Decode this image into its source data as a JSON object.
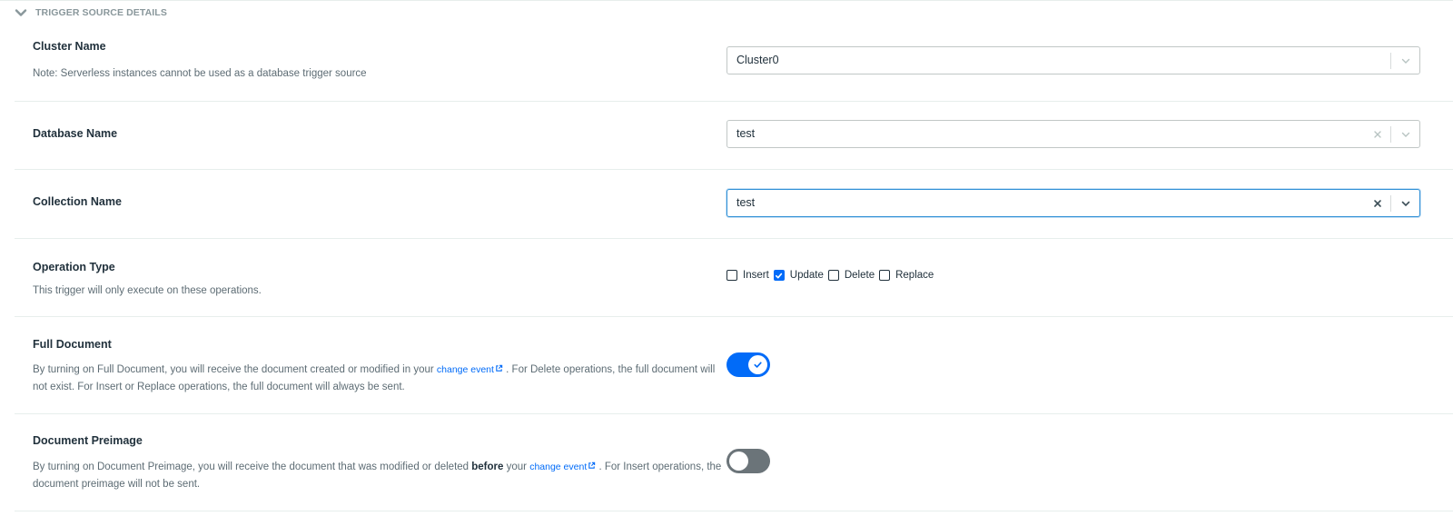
{
  "section": {
    "title": "TRIGGER SOURCE DETAILS",
    "icon": "chevron-down-icon"
  },
  "cluster": {
    "label": "Cluster Name",
    "note": "Note: Serverless instances cannot be used as a database trigger source",
    "value": "Cluster0"
  },
  "database": {
    "label": "Database Name",
    "value": "test"
  },
  "collection": {
    "label": "Collection Name",
    "value": "test"
  },
  "operation": {
    "label": "Operation Type",
    "note": "This trigger will only execute on these operations.",
    "options": [
      {
        "label": "Insert",
        "checked": false
      },
      {
        "label": "Update",
        "checked": true
      },
      {
        "label": "Delete",
        "checked": false
      },
      {
        "label": "Replace",
        "checked": false
      }
    ]
  },
  "full_document": {
    "label": "Full Document",
    "desc_before": "By turning on Full Document, you will receive the document created or modified in your ",
    "link": "change event",
    "desc_after": " . For Delete operations, the full document will not exist. For Insert or Replace operations, the full document will always be sent.",
    "enabled": true
  },
  "preimage": {
    "label": "Document Preimage",
    "desc_before": "By turning on Document Preimage, you will receive the document that was modified or deleted ",
    "desc_bold": "before",
    "desc_mid": " your ",
    "link": "change event",
    "desc_after": " . For Insert operations, the document preimage will not be sent.",
    "enabled": false
  },
  "colors": {
    "accent": "#016bf8",
    "toggle_off": "#6b7479",
    "focus_border": "#2e8fd6"
  }
}
